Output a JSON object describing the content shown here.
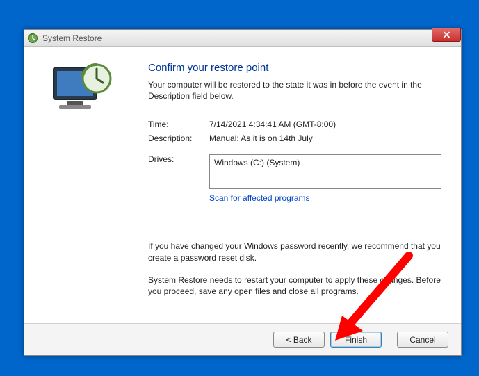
{
  "window": {
    "title": "System Restore"
  },
  "heading": "Confirm your restore point",
  "subheading": "Your computer will be restored to the state it was in before the event in the Description field below.",
  "fields": {
    "time_label": "Time:",
    "time_value": "7/14/2021 4:34:41 AM (GMT-8:00)",
    "description_label": "Description:",
    "description_value": "Manual: As it is on 14th July",
    "drives_label": "Drives:",
    "drives_value": "Windows (C:) (System)"
  },
  "scan_link": "Scan for affected programs",
  "info1": "If you have changed your Windows password recently, we recommend that you create a password reset disk.",
  "info2": "System Restore needs to restart your computer to apply these changes. Before you proceed, save any open files and close all programs.",
  "buttons": {
    "back": "< Back",
    "finish": "Finish",
    "cancel": "Cancel"
  }
}
